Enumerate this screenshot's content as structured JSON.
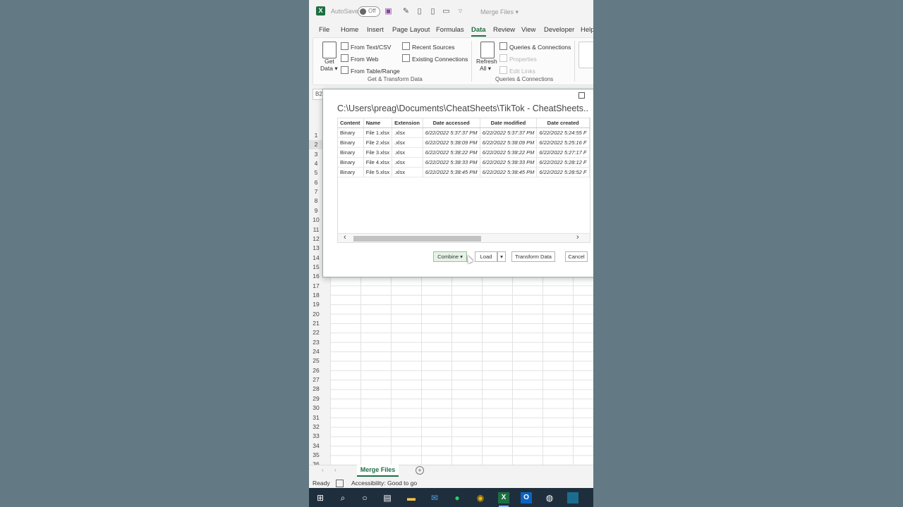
{
  "app": {
    "autosave_label": "AutoSave",
    "autosave_state": "Off",
    "filename": "Merge Files",
    "filename_caret": "▾"
  },
  "tabs": [
    "File",
    "Home",
    "Insert",
    "Page Layout",
    "Formulas",
    "Data",
    "Review",
    "View",
    "Developer",
    "Help"
  ],
  "active_tab": "Data",
  "ribbon": {
    "get_data_label": "Get",
    "get_data_label2": "Data ▾",
    "from_text_csv": "From Text/CSV",
    "from_web": "From Web",
    "from_table_range": "From Table/Range",
    "recent_sources": "Recent Sources",
    "existing_connections": "Existing Connections",
    "group_get_transform": "Get & Transform Data",
    "refresh_label": "Refresh",
    "refresh_label2": "All ▾",
    "queries_connections": "Queries & Connections",
    "properties": "Properties",
    "edit_links": "Edit Links",
    "group_queries": "Queries & Connections"
  },
  "namebox": "B2",
  "rows": [
    "1",
    "2",
    "3",
    "4",
    "5",
    "6",
    "7",
    "8",
    "9",
    "10",
    "11",
    "12",
    "13",
    "14",
    "15",
    "16",
    "17",
    "18",
    "19",
    "20",
    "21",
    "22",
    "23",
    "24",
    "25",
    "26",
    "27",
    "28",
    "29",
    "30",
    "31",
    "32",
    "33",
    "34",
    "35",
    "36"
  ],
  "dialog": {
    "path": "C:\\Users\\preag\\Documents\\CheatSheets\\TikTok - CheatSheets...",
    "columns": [
      "Content",
      "Name",
      "Extension",
      "Date accessed",
      "Date modified",
      "Date created"
    ],
    "rows": [
      [
        "Binary",
        "File 1.xlsx",
        ".xlsx",
        "6/22/2022 5:37:37 PM",
        "6/22/2022 5:37:37 PM",
        "6/22/2022 5:24:55 F"
      ],
      [
        "Binary",
        "File 2.xlsx",
        ".xlsx",
        "6/22/2022 5:38:09 PM",
        "6/22/2022 5:38:09 PM",
        "6/22/2022 5:25:16 F"
      ],
      [
        "Binary",
        "File 3.xlsx",
        ".xlsx",
        "6/22/2022 5:38:22 PM",
        "6/22/2022 5:38:22 PM",
        "6/22/2022 5:27:17 F"
      ],
      [
        "Binary",
        "File 4.xlsx",
        ".xlsx",
        "6/22/2022 5:38:33 PM",
        "6/22/2022 5:38:33 PM",
        "6/22/2022 5:28:12 F"
      ],
      [
        "Binary",
        "File 5.xlsx",
        ".xlsx",
        "6/22/2022 5:38:45 PM",
        "6/22/2022 5:38:45 PM",
        "6/22/2022 5:28:52 F"
      ]
    ],
    "buttons": {
      "combine": "Combine ▾",
      "load": "Load",
      "load_arrow": "▾",
      "transform": "Transform Data",
      "cancel": "Cancel"
    }
  },
  "sheet_tab": "Merge Files",
  "status": {
    "ready": "Ready",
    "accessibility": "Accessibility: Good to go"
  },
  "taskbar_icons": [
    "windows-icon",
    "search-icon",
    "cortana-icon",
    "task-view-icon",
    "file-explorer-icon",
    "mail-icon",
    "spotify-icon",
    "chrome-icon",
    "excel-icon",
    "outlook-icon",
    "obs-icon",
    "app-icon"
  ]
}
